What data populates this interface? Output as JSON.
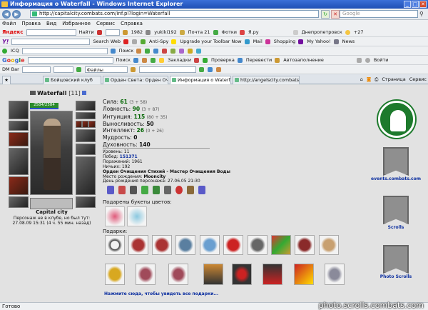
{
  "window": {
    "title": "Информация о Waterfall - Windows Internet Explorer"
  },
  "address": {
    "url": "http://capitalcity.combats.com/inf.pl?login=Waterfall",
    "search_placeholder": "Google"
  },
  "menu": [
    "Файл",
    "Правка",
    "Вид",
    "Избранное",
    "Сервис",
    "Справка"
  ],
  "toolbar_yandex": {
    "brand": "Яндекс",
    "find": "Найти",
    "count1": "1982",
    "user": "yukiki192",
    "mail": "Почта 21",
    "photos": "Фотки",
    "yaru": "Я.ру",
    "city": "Днепропетровск",
    "temp": "+27"
  },
  "toolbar_yahoo": {
    "brand": "Y!",
    "search_web": "Search Web",
    "antispy": "Anti-Spy",
    "upgrade": "Upgrade your Toolbar Now",
    "mail": "Mail",
    "shopping": "Shopping",
    "myyahoo": "My Yahoo!",
    "news": "News"
  },
  "toolbar_icq": {
    "label": "ICQ",
    "search": "Поиск"
  },
  "toolbar_google": {
    "search": "Поиск",
    "bookmarks": "Закладки",
    "check": "Проверка",
    "translate": "Перевести",
    "autofill": "Автозаполнение",
    "login": "Войти"
  },
  "toolbar_dm": {
    "label": "DM Bar",
    "files": "Файлы"
  },
  "tabs": [
    "Бойцовский клуб",
    "Орден Света: Орден Очищ...",
    "Информация о Waterfall",
    "http://angelscity.combats.co..."
  ],
  "tab_tools": {
    "page": "Страница",
    "service": "Сервис"
  },
  "character": {
    "name": "Waterfall",
    "level": "[11]",
    "hp": "2584/2584",
    "city": "Capital city",
    "status": "Персонаж не в клубе, но был тут:",
    "last_seen": "27.08.09 15:31 (4 ч. 55 мин. назад)"
  },
  "stats": [
    {
      "label": "Сила:",
      "value": "61",
      "extra": "(3 + 58)"
    },
    {
      "label": "Ловкость:",
      "value": "90",
      "extra": "(3 + 87)"
    },
    {
      "label": "Интуиция:",
      "value": "115",
      "extra": "(80 + 35)"
    },
    {
      "label": "Выносливость:",
      "value": "50",
      "extra": ""
    },
    {
      "label": "Интеллект:",
      "value": "26",
      "extra": "(0 + 26)"
    },
    {
      "label": "Мудрость:",
      "value": "0",
      "extra": ""
    },
    {
      "label": "Духовность:",
      "value": "140",
      "extra": ""
    }
  ],
  "details": {
    "level_label": "Уровень:",
    "level_value": "11",
    "wins_label": "Побед:",
    "wins_value": "151371",
    "losses_label": "Поражений:",
    "losses_value": "1961",
    "draws_label": "Ничьих:",
    "draws_value": "192",
    "order": "Орден Очищения Стихий - Мастер Очищения Воды",
    "birth_label": "Место рождения:",
    "birth_value": "Mooncity",
    "birthday_label": "День рождения персонажа:",
    "birthday_value": "27.06.05 21:30"
  },
  "bouquets_title": "Подарены букеты цветов:",
  "gifts_title": "Подарки:",
  "gifts_link": "Нажмите сюда, чтобы увидеть все подарки...",
  "sidebar": [
    {
      "label": "events.combats.com"
    },
    {
      "label": "Scrolls"
    },
    {
      "label": "Photo Scrolls"
    }
  ],
  "statusbar": {
    "text": "Готово"
  },
  "watermark": "photo.scrolls.combats.com"
}
